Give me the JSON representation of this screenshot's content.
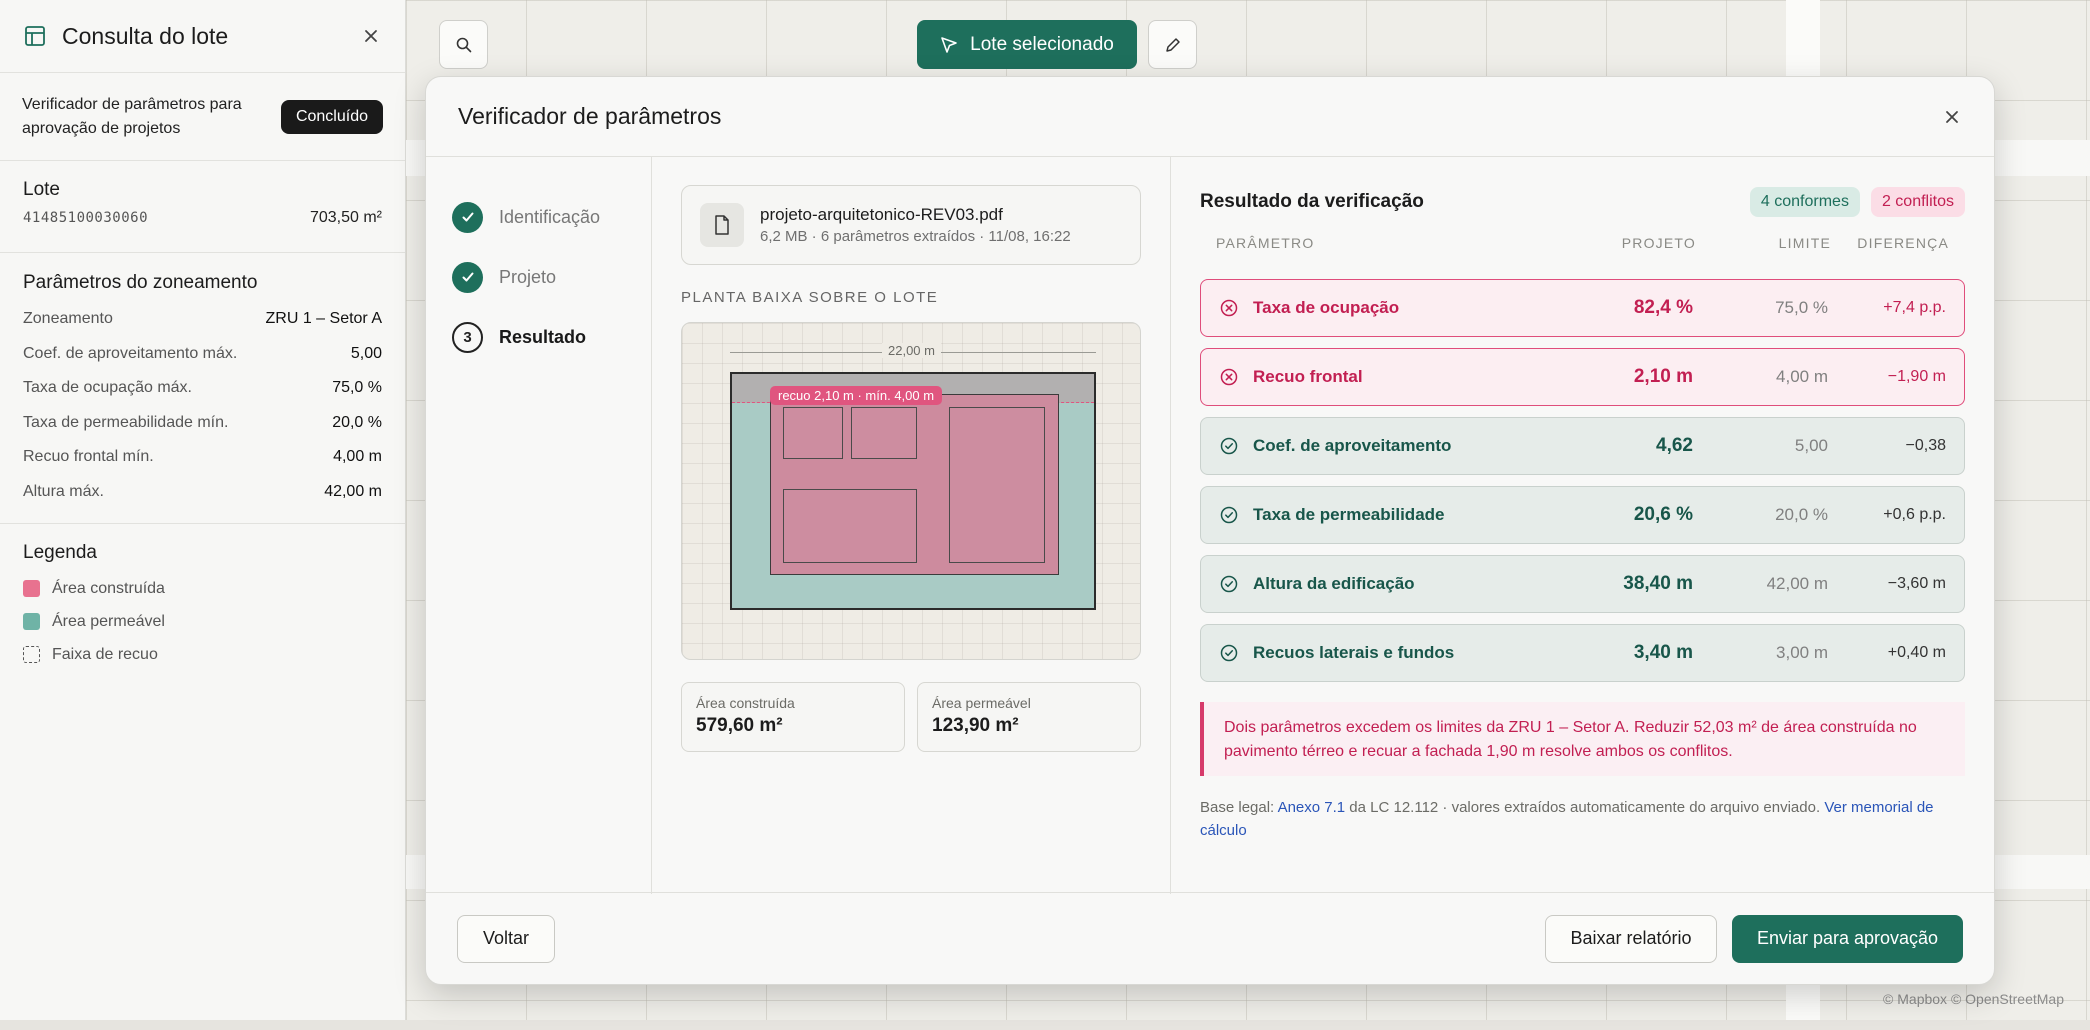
{
  "sidebar": {
    "title": "Consulta do lote",
    "task_text": "Verificador de parâmetros para aprovação de projetos",
    "done_label": "Concluído",
    "lote": {
      "heading": "Lote",
      "id": "41485100030060",
      "area": "703,50 m²"
    },
    "zoning": {
      "heading": "Parâmetros do zoneamento",
      "rows": [
        {
          "label": "Zoneamento",
          "value": "ZRU 1 – Setor A"
        },
        {
          "label": "Coef. de aproveitamento máx.",
          "value": "5,00"
        },
        {
          "label": "Taxa de ocupação máx.",
          "value": "75,0 %"
        },
        {
          "label": "Taxa de permeabilidade mín.",
          "value": "20,0 %"
        },
        {
          "label": "Recuo frontal mín.",
          "value": "4,00 m"
        },
        {
          "label": "Altura máx.",
          "value": "42,00 m"
        }
      ]
    },
    "legend": {
      "heading": "Legenda",
      "items": [
        {
          "label": "Área construída",
          "color": "#e8728f"
        },
        {
          "label": "Área permeável",
          "color": "#6fb3a6"
        },
        {
          "label": "Faixa de recuo",
          "color": "dashed"
        }
      ]
    }
  },
  "toolbar": {
    "selected_label": "Lote selecionado"
  },
  "modal": {
    "title": "Verificador de parâmetros",
    "steps": [
      {
        "label": "Identificação",
        "state": "done"
      },
      {
        "label": "Projeto",
        "state": "done"
      },
      {
        "label": "Resultado",
        "state": "current",
        "number": "3"
      }
    ],
    "file": {
      "name": "projeto-arquitetonico-REV03.pdf",
      "meta": "6,2 MB · 6 parâmetros extraídos · 11/08, 16:22"
    },
    "plan": {
      "label": "PLANTA BAIXA SOBRE O LOTE",
      "dimension": "22,00 m",
      "setback_tag": "recuo 2,10 m · mín. 4,00 m"
    },
    "stats": [
      {
        "label": "Área construída",
        "value": "579,60 m²"
      },
      {
        "label": "Área permeável",
        "value": "123,90 m²"
      }
    ],
    "result": {
      "title": "Resultado da verificação",
      "ok_badge": "4 conformes",
      "bad_badge": "2 conflitos",
      "columns": [
        "PARÂMETRO",
        "PROJETO",
        "LIMITE",
        "DIFERENÇA"
      ],
      "rows": [
        {
          "name": "Taxa de ocupação",
          "project": "82,4 %",
          "limit": "75,0 %",
          "diff": "+7,4 p.p.",
          "status": "conflict"
        },
        {
          "name": "Recuo frontal",
          "project": "2,10 m",
          "limit": "4,00 m",
          "diff": "−1,90 m",
          "status": "conflict"
        },
        {
          "name": "Coef. de aproveitamento",
          "project": "4,62",
          "limit": "5,00",
          "diff": "−0,38",
          "status": "ok"
        },
        {
          "name": "Taxa de permeabilidade",
          "project": "20,6 %",
          "limit": "20,0 %",
          "diff": "+0,6 p.p.",
          "status": "ok"
        },
        {
          "name": "Altura da edificação",
          "project": "38,40 m",
          "limit": "42,00 m",
          "diff": "−3,60 m",
          "status": "ok"
        },
        {
          "name": "Recuos laterais e fundos",
          "project": "3,40 m",
          "limit": "3,00 m",
          "diff": "+0,40 m",
          "status": "ok"
        }
      ],
      "alert": "Dois parâmetros excedem os limites da ZRU 1 – Setor A. Reduzir 52,03 m² de área construída no pavimento térreo e recuar a fachada 1,90 m resolve ambos os conflitos.",
      "legal_prefix": "Base legal: ",
      "legal_link1": "Anexo 7.1",
      "legal_middle": " da LC 12.112 · valores extraídos automaticamente do arquivo enviado. ",
      "legal_link2": "Ver memorial de cálculo"
    },
    "footer": {
      "back": "Voltar",
      "report": "Baixar relatório",
      "send": "Enviar para aprovação"
    }
  },
  "map": {
    "attribution": "© Mapbox © OpenStreetMap"
  },
  "colors": {
    "accent": "#1e6f5c",
    "conflict": "#c21f52"
  }
}
